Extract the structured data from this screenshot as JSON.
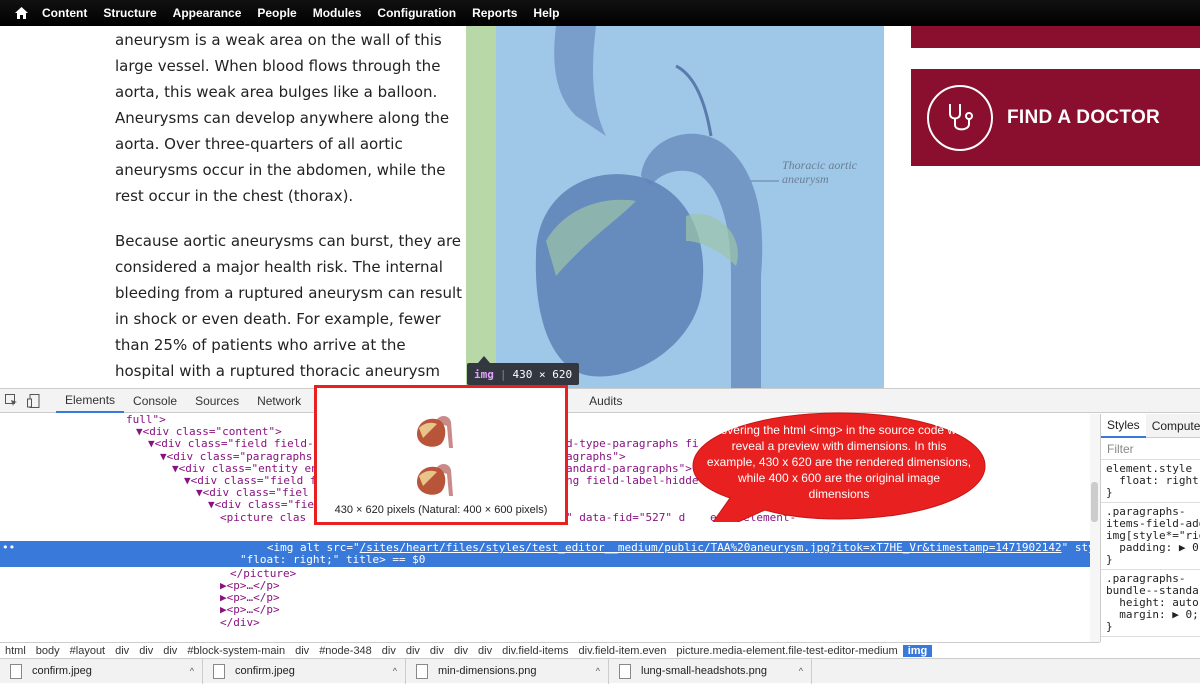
{
  "toolbar": {
    "items": [
      "Content",
      "Structure",
      "Appearance",
      "People",
      "Modules",
      "Configuration",
      "Reports",
      "Help"
    ]
  },
  "article": {
    "para1": "aneurysm is a weak area on the wall of this large vessel. When blood flows through the aorta, this weak area bulges like a balloon. Aneurysms can develop anywhere along the aorta. Over three-quarters of all aortic aneurysms occur in the abdomen, while the rest occur in the chest (thorax).",
    "para2": "Because aortic aneurysms can burst, they are considered a major health risk. The internal bleeding from a ruptured aneurysm can result in shock or even death. For example, fewer than 25% of patients who arrive at the hospital with a ruptured thoracic aneurysm survive.",
    "image_label": "Thoracic aortic aneurysm"
  },
  "sidebar": {
    "find_doctor": "FIND A DOCTOR"
  },
  "img_tooltip": {
    "tag": "img",
    "size": "430 × 620"
  },
  "devtools": {
    "tabs": [
      "Elements",
      "Console",
      "Sources",
      "Network",
      "Audits"
    ],
    "active_tab": "Elements",
    "lines": [
      "full\">",
      "▼<div class=\"content\">",
      "▼<div class=\"field field-",
      "▼<div class=\"paragraphs",
      "▼<div class=\"entity en",
      "▼<div class=\"field f",
      "▼<div class=\"fiel",
      "▼<div class=\"fie",
      "<picture clas"
    ],
    "right_fragments": [
      "d-type-paragraphs fi",
      "agraphs\">",
      "andard-paragraphs\">",
      "ng field-label-hidde"
    ],
    "picture_tail": "\" data-fid=\"527\" d",
    "picture_tail2": "edia-element-",
    "selected_prefix": "<img alt src=\"",
    "selected_src": "/sites/heart/files/styles/test_editor__medium/public/TAA%20aneurysm.jpg?itok=xT7HE_Vr&timestamp=1471902142",
    "selected_suffix": "\" style=",
    "selected_line2": "\"float: right;\" title> == $0",
    "after_lines": [
      "</picture>",
      "▶<p>…</p>",
      "▶<p>…</p>",
      "▶<p>…</p>",
      "</div>"
    ],
    "styles_tabs": [
      "Styles",
      "Computed"
    ],
    "filter": "Filter",
    "rules": [
      "element.style {\n  float: right\n}",
      ".paragraphs-\nitems-field-add\nimg[style*=\"rig\n  padding: ▶ 0\n}",
      ".paragraphs-\nbundle--standar\n  height: auto\n  margin: ▶ 0;\n}"
    ],
    "breadcrumbs": [
      "html",
      "body",
      "#layout",
      "div",
      "div",
      "div",
      "#block-system-main",
      "div",
      "#node-348",
      "div",
      "div",
      "div",
      "div",
      "div",
      "div.field-items",
      "div.field-item.even",
      "picture.media-element.file-test-editor-medium",
      "img"
    ]
  },
  "downloads": [
    "confirm.jpeg",
    "confirm.jpeg",
    "min-dimensions.png",
    "lung-small-headshots.png"
  ],
  "preview": {
    "caption": "430 × 620 pixels (Natural: 400 × 600 pixels)"
  },
  "annotation": {
    "text": "hovering the html <img> in the source code will reveal a preview with dimensions. In this example, 430 x 620 are the rendered dimensions, while 400 x 600 are the original image dimensions"
  },
  "colors": {
    "highlight": "#9fc7e8",
    "padding": "#b8d8a8",
    "brand": "#8a0f2e",
    "annotation": "#e82020",
    "selection": "#3879d9"
  }
}
